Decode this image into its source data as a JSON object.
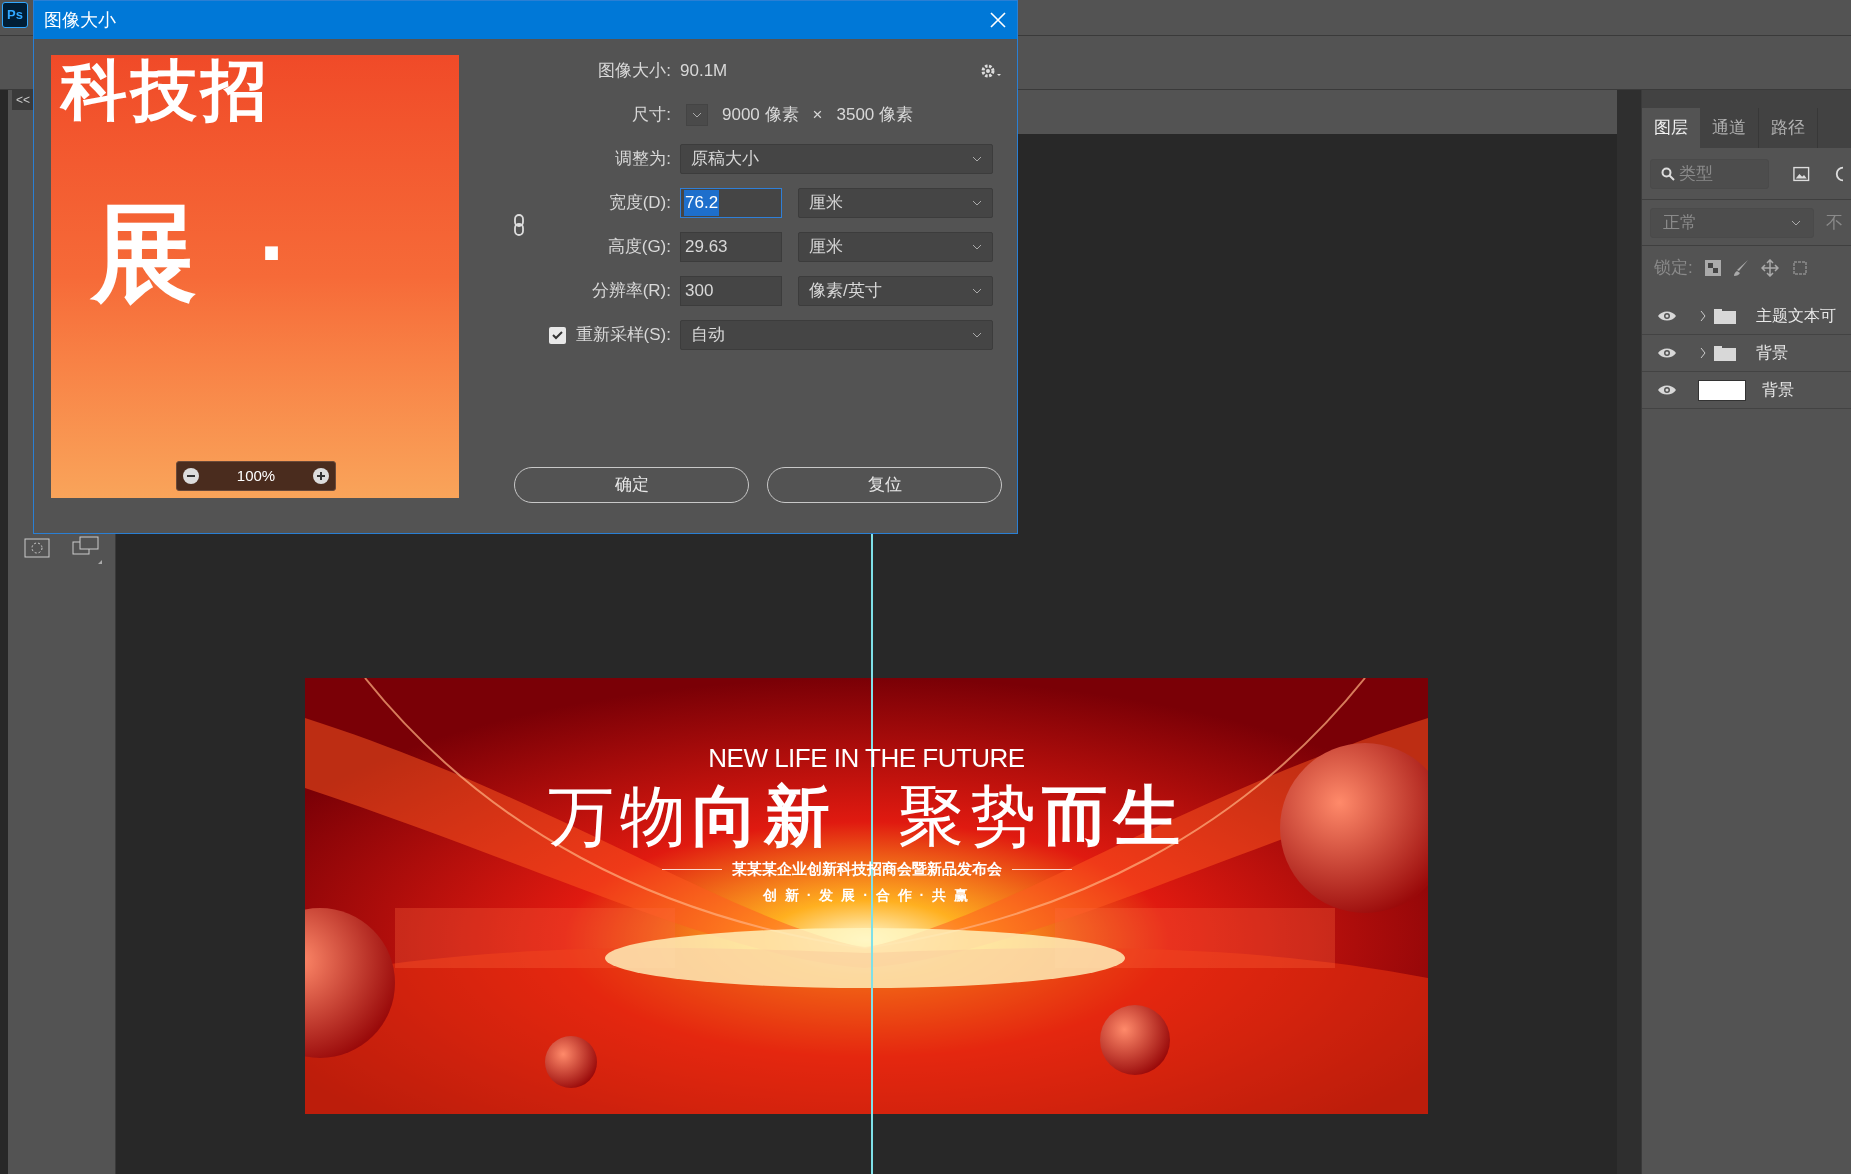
{
  "app": {
    "logo": "Ps",
    "toolbar_toggle": "<<"
  },
  "dialog": {
    "title": "图像大小",
    "image_size": {
      "label": "图像大小:",
      "value": "90.1M"
    },
    "dimensions": {
      "label": "尺寸:",
      "width": "9000 像素",
      "times": "×",
      "height": "3500 像素"
    },
    "fit_to": {
      "label": "调整为:",
      "value": "原稿大小"
    },
    "fields": [
      {
        "label": "宽度(D):",
        "value": "76.2",
        "unit": "厘米",
        "focused": true
      },
      {
        "label": "高度(G):",
        "value": "29.63",
        "unit": "厘米",
        "focused": false
      },
      {
        "label": "分辨率(R):",
        "value": "300",
        "unit": "像素/英寸",
        "focused": false
      }
    ],
    "resample": {
      "label": "重新采样(S):",
      "checked": true,
      "value": "自动"
    },
    "preview": {
      "top_text": "科技招",
      "middle_text": "展",
      "dot": "·",
      "zoom": "100%"
    },
    "buttons": [
      "确定",
      "复位"
    ]
  },
  "layers_panel": {
    "tabs": [
      {
        "label": "图层",
        "selected": true
      },
      {
        "label": "通道",
        "selected": false
      },
      {
        "label": "路径",
        "selected": false
      }
    ],
    "filter_placeholder": "类型",
    "blend_mode": "正常",
    "opacity_label": "不",
    "lock_label": "锁定:",
    "layers": [
      {
        "name": "主题文本可",
        "kind": "group",
        "visible": true
      },
      {
        "name": "背景",
        "kind": "group",
        "visible": true
      },
      {
        "name": "背景",
        "kind": "layer",
        "visible": true
      }
    ]
  },
  "canvas": {
    "tagline": "NEW LIFE IN THE FUTURE",
    "headline": [
      "万物**向新**",
      "聚势**而生**"
    ],
    "subtitle": "某某某企业创新科技招商会暨新品发布会",
    "slogan": "创 新 · 发 展 · 合 作 · 共 赢"
  }
}
